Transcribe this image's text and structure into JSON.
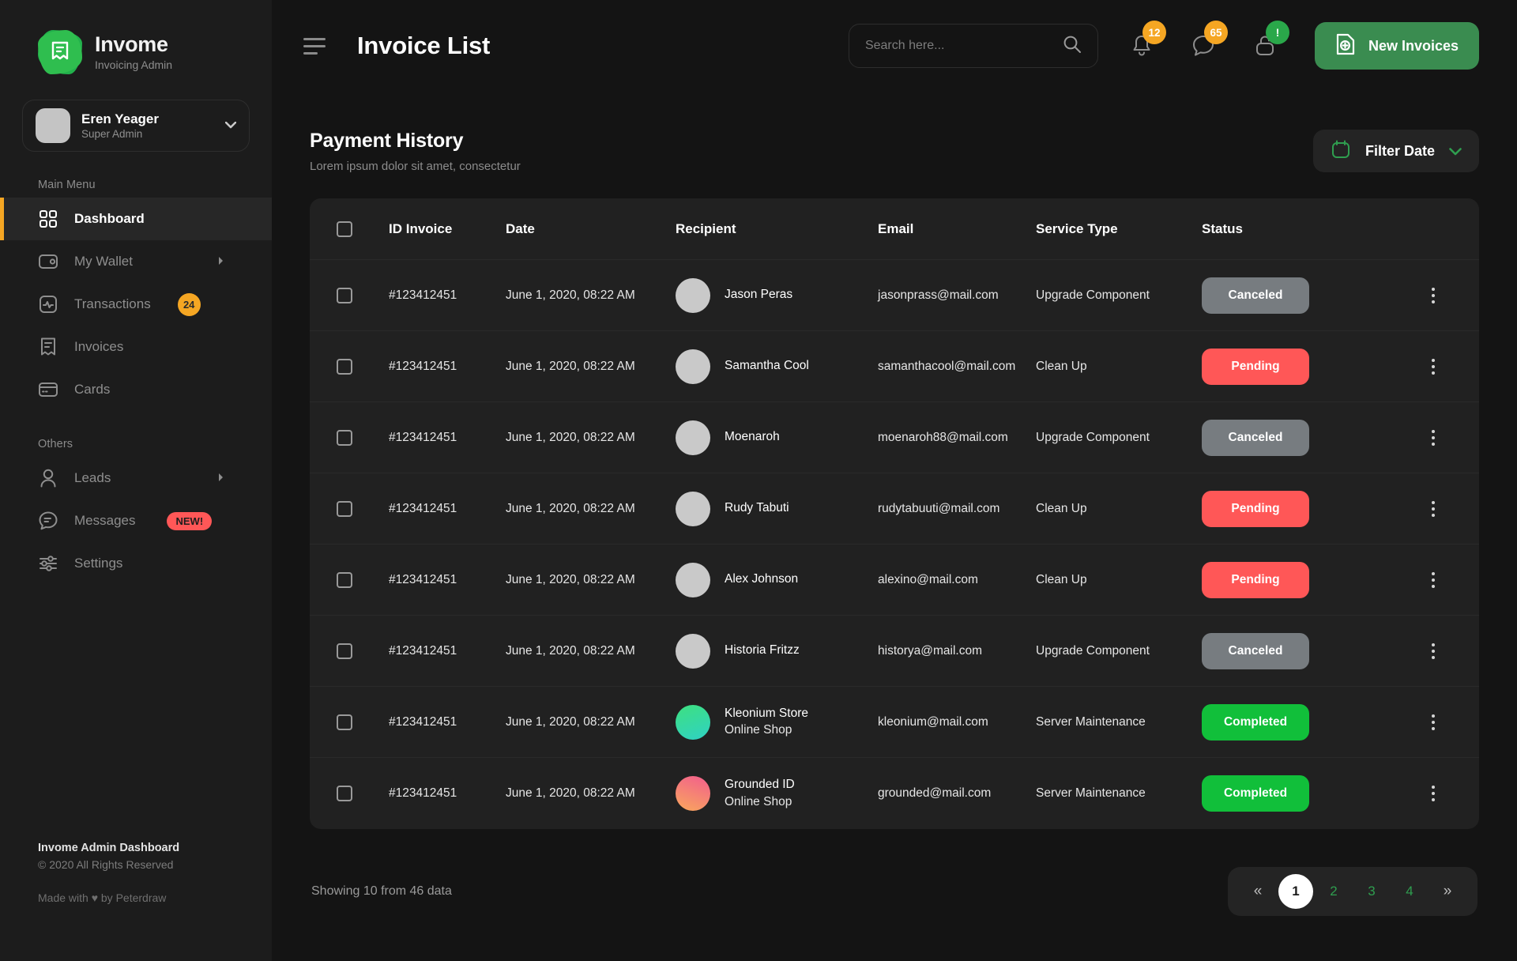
{
  "brand": {
    "name": "Invome",
    "tagline": "Invoicing Admin",
    "logo_icon": "invoice-badge-icon"
  },
  "profile": {
    "name": "Eren Yeager",
    "role": "Super Admin",
    "caret_icon": "chevron-down-icon"
  },
  "sidebar": {
    "main_label": "Main Menu",
    "others_label": "Others",
    "main_items": [
      {
        "label": "Dashboard",
        "icon": "grid-icon",
        "active": true,
        "badge": "",
        "arrow": false
      },
      {
        "label": "My Wallet",
        "icon": "wallet-icon",
        "active": false,
        "badge": "",
        "arrow": true
      },
      {
        "label": "Transactions",
        "icon": "activity-icon",
        "active": false,
        "badge": "24",
        "arrow": false
      },
      {
        "label": "Invoices",
        "icon": "invoice-icon",
        "active": false,
        "badge": "",
        "arrow": false
      },
      {
        "label": "Cards",
        "icon": "credit-card-icon",
        "active": false,
        "badge": "",
        "arrow": false
      }
    ],
    "other_items": [
      {
        "label": "Leads",
        "icon": "user-icon",
        "badge": "",
        "arrow": true
      },
      {
        "label": "Messages",
        "icon": "chat-icon",
        "badge": "NEW!",
        "arrow": false
      },
      {
        "label": "Settings",
        "icon": "settings-icon",
        "badge": "",
        "arrow": false
      }
    ],
    "footer": {
      "title": "Invome Admin Dashboard",
      "copyright": "© 2020 All Rights Reserved",
      "credit": "Made with ♥ by Peterdraw"
    }
  },
  "header": {
    "menu_icon": "hamburger-icon",
    "title": "Invoice List",
    "search": {
      "placeholder": "Search here...",
      "value": "",
      "icon": "search-icon"
    },
    "icons": [
      {
        "name": "bell-icon",
        "count": "12",
        "accent": "#f5a623"
      },
      {
        "name": "chat-icon",
        "count": "65",
        "accent": "#f5a623"
      },
      {
        "name": "lock-icon",
        "count": "!",
        "accent": "#2aa84a"
      }
    ],
    "new_button": {
      "label": "New Invoices",
      "icon": "file-plus-icon",
      "color": "#3a8c50"
    }
  },
  "section": {
    "title": "Payment History",
    "subtitle": "Lorem ipsum dolor sit amet, consectetur",
    "filter": {
      "label": "Filter Date",
      "icon": "calendar-icon",
      "caret": "chevron-down-icon"
    }
  },
  "table": {
    "columns": [
      "ID Invoice",
      "Date",
      "Recipient",
      "Email",
      "Service Type",
      "Status"
    ],
    "rows": [
      {
        "id": "#123412451",
        "date": "June 1, 2020, 08:22 AM",
        "name": "Jason Peras",
        "sub": "",
        "avatar": "plain",
        "email": "jasonprass@mail.com",
        "service": "Upgrade Component",
        "status": "Canceled",
        "status_kind": "canceled"
      },
      {
        "id": "#123412451",
        "date": "June 1, 2020, 08:22 AM",
        "name": "Samantha Cool",
        "sub": "",
        "avatar": "plain",
        "email": "samanthacool@mail.com",
        "service": "Clean Up",
        "status": "Pending",
        "status_kind": "pending"
      },
      {
        "id": "#123412451",
        "date": "June 1, 2020, 08:22 AM",
        "name": "Moenaroh",
        "sub": "",
        "avatar": "plain",
        "email": "moenaroh88@mail.com",
        "service": "Upgrade Component",
        "status": "Canceled",
        "status_kind": "canceled"
      },
      {
        "id": "#123412451",
        "date": "June 1, 2020, 08:22 AM",
        "name": "Rudy Tabuti",
        "sub": "",
        "avatar": "plain",
        "email": "rudytabuuti@mail.com",
        "service": "Clean Up",
        "status": "Pending",
        "status_kind": "pending"
      },
      {
        "id": "#123412451",
        "date": "June 1, 2020, 08:22 AM",
        "name": "Alex Johnson",
        "sub": "",
        "avatar": "plain",
        "email": "alexino@mail.com",
        "service": "Clean Up",
        "status": "Pending",
        "status_kind": "pending"
      },
      {
        "id": "#123412451",
        "date": "June 1, 2020, 08:22 AM",
        "name": "Historia Fritzz",
        "sub": "",
        "avatar": "plain",
        "email": "historya@mail.com",
        "service": "Upgrade Component",
        "status": "Canceled",
        "status_kind": "canceled"
      },
      {
        "id": "#123412451",
        "date": "June 1, 2020, 08:22 AM",
        "name": "Kleonium Store",
        "sub": "Online Shop",
        "avatar": "g-green",
        "email": "kleonium@mail.com",
        "service": "Server Maintenance",
        "status": "Completed",
        "status_kind": "completed"
      },
      {
        "id": "#123412451",
        "date": "June 1, 2020, 08:22 AM",
        "name": "Grounded ID",
        "sub": "Online Shop",
        "avatar": "g-pink",
        "email": "grounded@mail.com",
        "service": "Server Maintenance",
        "status": "Completed",
        "status_kind": "completed"
      }
    ]
  },
  "footer": {
    "showing": "Showing 10 from 46 data",
    "pages": [
      "1",
      "2",
      "3",
      "4"
    ],
    "active_page": "1",
    "prev_icon": "«",
    "next_icon": "»"
  },
  "colors": {
    "accent_green": "#2f9e4f",
    "accent_orange": "#f5a623",
    "danger_red": "#ff5757",
    "success_green": "#11bf3a",
    "neutral_gray": "#777c80"
  }
}
